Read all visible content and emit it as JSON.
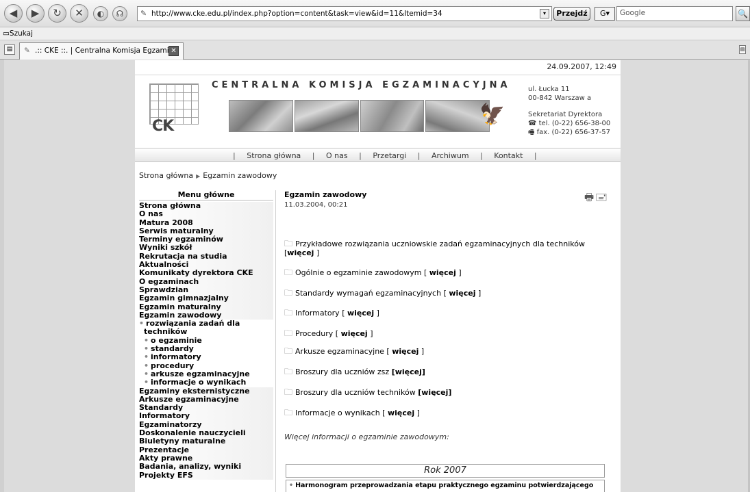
{
  "browser": {
    "url": "http://www.cke.edu.pl/index.php?option=content&task=view&id=11&Itemid=34",
    "go_label": "Przejdź",
    "g_label": "G▾",
    "search_placeholder": "Google",
    "bookmark_label": "Szukaj",
    "tab_label": ".:: CKE ::. | Centralna Komisja Egzami...",
    "icons": {
      "back": "◀",
      "forward": "▶",
      "reload": "↻",
      "stop": "✕",
      "home": "◐",
      "rss": "☊",
      "page": "✎",
      "addr_drop": "▾",
      "search": "🔍",
      "bookmark_folder": "▭",
      "tab_new": "▤",
      "tab_close": "✕",
      "tab_list": "▤"
    }
  },
  "page": {
    "datetime": "24.09.2007, 12:49",
    "org_name": "CENTRALNA KOMISJA EGZAMINACYJNA",
    "logo_text": "CK",
    "address": {
      "street": "ul. Łucka 11",
      "city": "00-842 Warszaw a",
      "secretariat": "Sekretariat Dyrektora",
      "tel": "☎ tel. (0-22) 656-38-00",
      "fax": "🖷 fax. (0-22) 656-37-57"
    },
    "eagle_glyph": "🦅",
    "menubar": [
      {
        "label": "Strona główna"
      },
      {
        "label": "O nas"
      },
      {
        "label": "Przetargi"
      },
      {
        "label": "Archiwum"
      },
      {
        "label": "Kontakt"
      }
    ],
    "breadcrumb": {
      "home": "Strona główna",
      "arrow": "▶",
      "current": "Egzamin zawodowy"
    },
    "left_menu": {
      "title": "Menu główne",
      "items": [
        {
          "label": "Strona główna",
          "type": "main"
        },
        {
          "label": "O nas",
          "type": "main"
        },
        {
          "label": "Matura 2008",
          "type": "main"
        },
        {
          "label": "Serwis maturalny",
          "type": "main"
        },
        {
          "label": "Terminy egzaminów",
          "type": "main"
        },
        {
          "label": "Wyniki szkół",
          "type": "main"
        },
        {
          "label": "Rekrutacja na studia",
          "type": "main"
        },
        {
          "label": "Aktualności",
          "type": "main"
        },
        {
          "label": "Komunikaty dyrektora CKE",
          "type": "main"
        },
        {
          "label": "O egzaminach",
          "type": "main"
        },
        {
          "label": "Sprawdzian",
          "type": "main"
        },
        {
          "label": "Egzamin gimnazjalny",
          "type": "main"
        },
        {
          "label": "Egzamin maturalny",
          "type": "main"
        },
        {
          "label": "Egzamin zawodowy",
          "type": "main"
        },
        {
          "label": "rozwiązania zadań dla techników",
          "type": "sub-wrap"
        },
        {
          "label": "o egzaminie",
          "type": "sub"
        },
        {
          "label": "standardy",
          "type": "sub"
        },
        {
          "label": "informatory",
          "type": "sub"
        },
        {
          "label": "procedury",
          "type": "sub"
        },
        {
          "label": "arkusze egzaminacyjne",
          "type": "sub"
        },
        {
          "label": "informacje o wynikach",
          "type": "sub"
        },
        {
          "label": "Egzaminy eksternistyczne",
          "type": "main"
        },
        {
          "label": "Arkusze egzaminacyjne",
          "type": "main"
        },
        {
          "label": "Standardy",
          "type": "main"
        },
        {
          "label": "Informatory",
          "type": "main"
        },
        {
          "label": "Egzaminatorzy",
          "type": "main"
        },
        {
          "label": "Doskonalenie nauczycieli",
          "type": "main"
        },
        {
          "label": "Biuletyny maturalne",
          "type": "main"
        },
        {
          "label": "Prezentacje",
          "type": "main"
        },
        {
          "label": "Akty prawne",
          "type": "main"
        },
        {
          "label": "Badania, analizy, wyniki",
          "type": "main"
        },
        {
          "label": "Projekty EFS",
          "type": "main"
        }
      ]
    },
    "content": {
      "title": "Egzamin zawodowy",
      "date": "11.03.2004, 00:21",
      "print_icons": "🖶🖃",
      "folder_icon": "🗀",
      "entries": [
        {
          "text": "Przykładowe rozwiązania uczniowskie zadań egzaminacyjnych dla techników [",
          "link": "więcej",
          "close": " ]"
        },
        {
          "text": "Ogólnie o egzaminie zawodowym [ ",
          "link": "więcej",
          "close": " ]"
        },
        {
          "text": "Standardy wymagań egzaminacyjnych   [ ",
          "link": "więcej",
          "close": " ]"
        },
        {
          "text": "Informatory [ ",
          "link": "więcej",
          "close": " ]"
        },
        {
          "text": "Procedury [ ",
          "link": "więcej",
          "close": " ]"
        },
        {
          "text": "Arkusze egzaminacyjne [ ",
          "link": "więcej",
          "close": " ]"
        },
        {
          "text": "Broszury dla uczniów zsz ",
          "link": "[więcej]",
          "close": ""
        },
        {
          "text": "Broszury dla uczniów techników ",
          "link": "[więcej]",
          "close": ""
        },
        {
          "text": "Informacje o wynikach [ ",
          "link": "więcej",
          "close": " ]"
        }
      ],
      "more_info": "Więcej informacji o egzaminie zawodowym:",
      "year_label": "Rok 2007",
      "harmonogram": "Harmonogram przeprowadzania etapu praktycznego egzaminu potwierdzającego"
    }
  }
}
